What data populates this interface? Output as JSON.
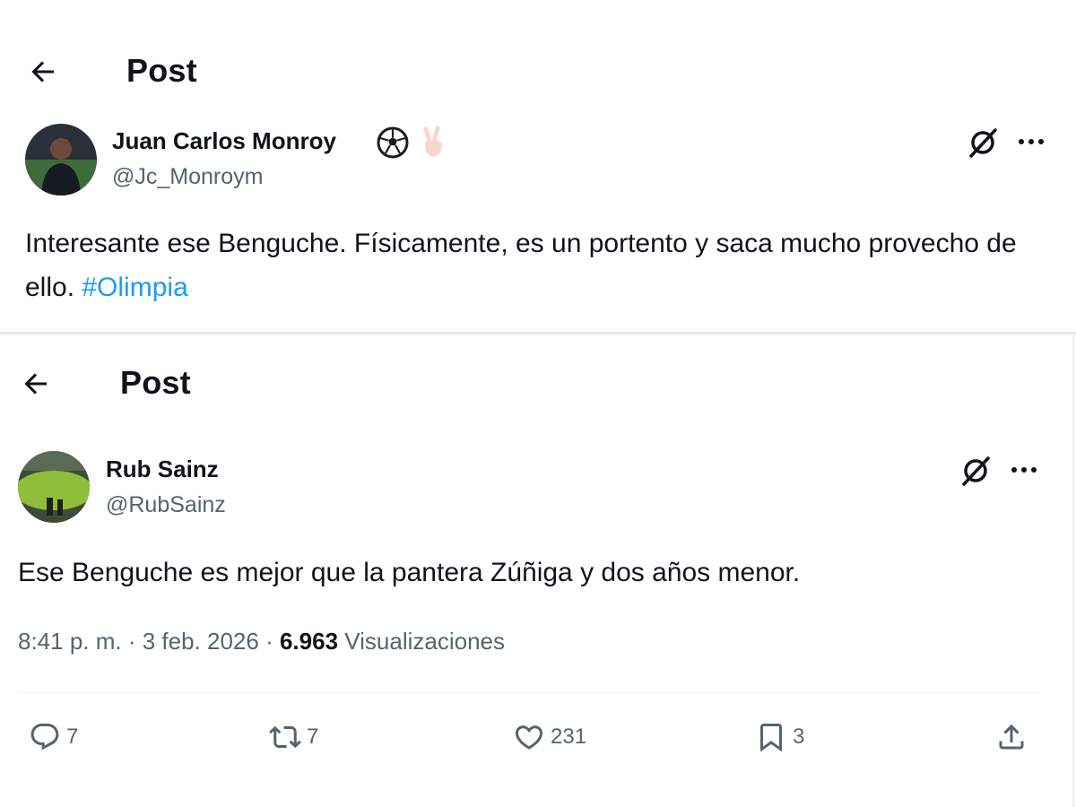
{
  "post1": {
    "header_title": "Post",
    "author": {
      "name": "Juan Carlos Monroy",
      "handle": "@Jc_Monroym",
      "name_emojis": [
        "soccer-ball-icon",
        "victory-hand-icon"
      ]
    },
    "text_main": "Interesante ese Benguche. Físicamente, es un portento y saca mucho provecho de ello. ",
    "hashtag": "#Olimpia"
  },
  "post2": {
    "header_title": "Post",
    "author": {
      "name": "Rub Sainz",
      "handle": "@RubSainz"
    },
    "text": "Ese Benguche es mejor que la pantera Zúñiga y dos años menor.",
    "meta": {
      "time": "8:41 p. m.",
      "sep1": " · ",
      "date": "3 feb. 2026",
      "sep2": " · ",
      "views_count": "6.963",
      "views_label": " Visualizaciones"
    },
    "actions": {
      "replies": "7",
      "reposts": "7",
      "likes": "231",
      "bookmarks": "3"
    }
  },
  "colors": {
    "text": "#0f1419",
    "secondary": "#536471",
    "link": "#1d9bf0",
    "divider": "#eff3f4"
  }
}
